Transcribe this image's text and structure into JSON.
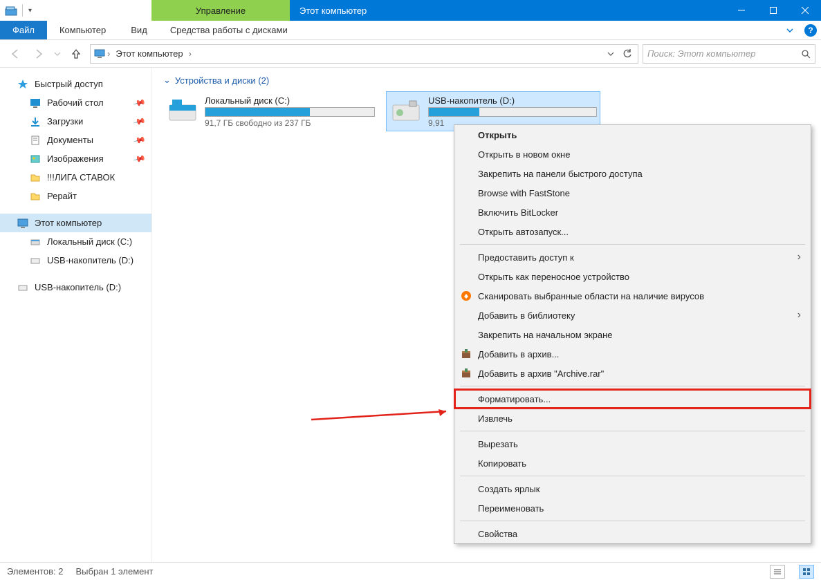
{
  "titlebar": {
    "context_tab": "Управление",
    "title": "Этот компьютер"
  },
  "ribbon": {
    "file": "Файл",
    "tabs": [
      "Компьютер",
      "Вид"
    ],
    "context_tab": "Средства работы с дисками"
  },
  "addressbar": {
    "crumb": "Этот компьютер"
  },
  "search": {
    "placeholder": "Поиск: Этот компьютер"
  },
  "sidebar": {
    "quick_access": "Быстрый доступ",
    "items": [
      {
        "label": "Рабочий стол",
        "pinned": true,
        "icon": "desktop"
      },
      {
        "label": "Загрузки",
        "pinned": true,
        "icon": "downloads"
      },
      {
        "label": "Документы",
        "pinned": true,
        "icon": "documents"
      },
      {
        "label": "Изображения",
        "pinned": true,
        "icon": "pictures"
      },
      {
        "label": "!!!ЛИГА СТАВОК",
        "pinned": false,
        "icon": "folder"
      },
      {
        "label": "Рерайт",
        "pinned": false,
        "icon": "folder"
      }
    ],
    "this_pc": "Этот компьютер",
    "drives": [
      {
        "label": "Локальный диск (C:)",
        "icon": "hdd"
      },
      {
        "label": "USB-накопитель (D:)",
        "icon": "usb"
      }
    ],
    "removable": {
      "label": "USB-накопитель (D:)"
    }
  },
  "main": {
    "group_header": "Устройства и диски (2)",
    "drives": [
      {
        "name": "Локальный диск (C:)",
        "free_text": "91,7 ГБ свободно из 237 ГБ",
        "fill_pct": 62,
        "selected": false
      },
      {
        "name": "USB-накопитель (D:)",
        "free_text": "9,91",
        "fill_pct": 30,
        "selected": true
      }
    ]
  },
  "context_menu": {
    "items": [
      {
        "label": "Открыть",
        "bold": true
      },
      {
        "label": "Открыть в новом окне"
      },
      {
        "label": "Закрепить на панели быстрого доступа"
      },
      {
        "label": "Browse with FastStone"
      },
      {
        "label": "Включить BitLocker"
      },
      {
        "label": "Открыть автозапуск..."
      },
      {
        "sep": true
      },
      {
        "label": "Предоставить доступ к",
        "submenu": true
      },
      {
        "label": "Открыть как переносное устройство"
      },
      {
        "label": "Сканировать выбранные области на наличие вирусов",
        "icon": "avast"
      },
      {
        "label": "Добавить в библиотеку",
        "submenu": true
      },
      {
        "label": "Закрепить на начальном экране"
      },
      {
        "label": "Добавить в архив...",
        "icon": "winrar"
      },
      {
        "label": "Добавить в архив \"Archive.rar\"",
        "icon": "winrar"
      },
      {
        "sep": true
      },
      {
        "label": "Форматировать...",
        "highlighted": true
      },
      {
        "label": "Извлечь"
      },
      {
        "sep": true
      },
      {
        "label": "Вырезать"
      },
      {
        "label": "Копировать"
      },
      {
        "sep": true
      },
      {
        "label": "Создать ярлык"
      },
      {
        "label": "Переименовать"
      },
      {
        "sep": true
      },
      {
        "label": "Свойства"
      }
    ]
  },
  "status": {
    "count": "Элементов: 2",
    "selection": "Выбран 1 элемент"
  }
}
